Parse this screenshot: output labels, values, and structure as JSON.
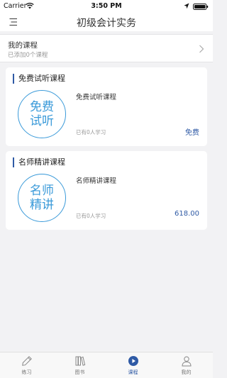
{
  "status_bar": {
    "carrier": "Carrier",
    "time": "3:50 PM"
  },
  "nav": {
    "title": "初级会计实务",
    "menu_icon": "menu-icon"
  },
  "my_course": {
    "title": "我的课程",
    "subtitle": "已添加0个课程",
    "chevron_icon": "chevron-right-icon"
  },
  "cards": [
    {
      "header": "免费试听课程",
      "badge": "免费试听",
      "name": "免费试听课程",
      "learners": "已有0人学习",
      "price": "免费"
    },
    {
      "header": "名师精讲课程",
      "badge": "名师精讲",
      "name": "名师精讲课程",
      "learners": "已有0人学习",
      "price": "618.00"
    }
  ],
  "tabs": [
    {
      "label": "练习",
      "icon": "pencil-icon"
    },
    {
      "label": "图书",
      "icon": "books-icon"
    },
    {
      "label": "课程",
      "icon": "play-circle-icon"
    },
    {
      "label": "我的",
      "icon": "user-icon"
    }
  ],
  "active_tab": "课程",
  "colors": {
    "accent": "#2f5aa5",
    "badge": "#3a9ad9",
    "background": "#f2f2f4"
  }
}
